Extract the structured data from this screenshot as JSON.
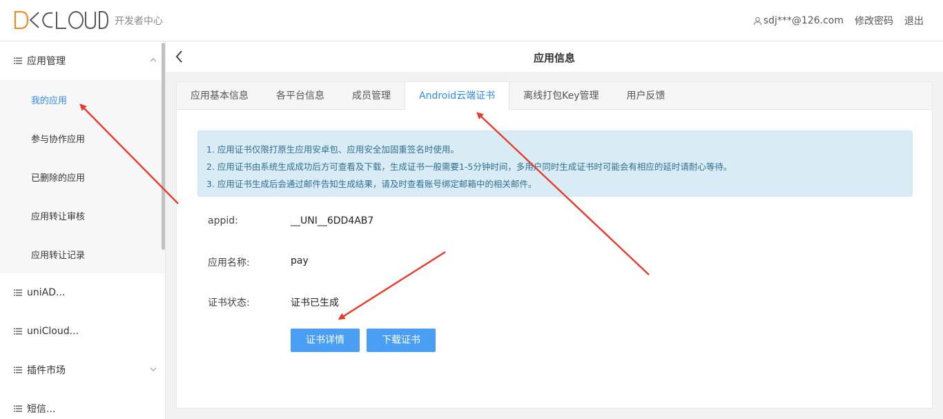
{
  "header": {
    "logo_text": "DCLOUD",
    "subtitle": "开发者中心",
    "user": "sdj***@126.com",
    "change_password": "修改密码",
    "logout": "退出"
  },
  "sidebar": {
    "groups": [
      {
        "label": "应用管理",
        "expanded": true,
        "items": [
          {
            "label": "我的应用",
            "active": true
          },
          {
            "label": "参与协作应用"
          },
          {
            "label": "已删除的应用"
          },
          {
            "label": "应用转让审核"
          },
          {
            "label": "应用转让记录"
          }
        ]
      },
      {
        "label": "uniAD..."
      },
      {
        "label": "uniCloud..."
      },
      {
        "label": "插件市场"
      },
      {
        "label": "短信..."
      }
    ]
  },
  "content": {
    "title": "应用信息",
    "tabs": [
      {
        "label": "应用基本信息"
      },
      {
        "label": "各平台信息"
      },
      {
        "label": "成员管理"
      },
      {
        "label": "Android云端证书",
        "active": true
      },
      {
        "label": "离线打包Key管理"
      },
      {
        "label": "用户反馈"
      }
    ],
    "notice": [
      "1. 应用证书仅限打原生应用安卓包、应用安全加固重签名时使用。",
      "2. 应用证书由系统生成成功后方可查看及下载，生成证书一般需要1-5分钟时间，多用户同时生成证书时可能会有相应的延时请耐心等待。",
      "3. 应用证书生成后会通过邮件告知生成结果，请及时查看账号绑定邮箱中的相关邮件。"
    ],
    "fields": {
      "appid_label": "appid:",
      "appid_value": "__UNI__6DD4AB7",
      "name_label": "应用名称:",
      "name_value": "pay",
      "status_label": "证书状态:",
      "status_value": "证书已生成"
    },
    "buttons": {
      "detail": "证书详情",
      "download": "下载证书"
    }
  },
  "colors": {
    "accent": "#2d8cf0",
    "button": "#4a9ff5",
    "notice_bg": "#d9ecf5",
    "annotation_arrow": "#e8392c",
    "logo_orange": "#f08a24"
  }
}
